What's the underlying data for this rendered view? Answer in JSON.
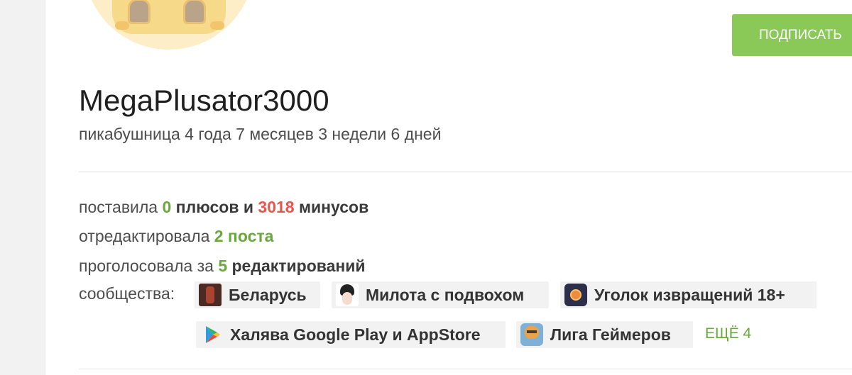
{
  "header": {
    "subscribe_label": "ПОДПИСАТЬ"
  },
  "profile": {
    "username": "MegaPlusator3000",
    "age_text": "пикабушница 4 года 7 месяцев 3 недели 6 дней"
  },
  "stats": {
    "votes": {
      "prefix": "поставила",
      "plus_count": "0",
      "plus_word": "плюсов и",
      "minus_count": "3018",
      "minus_word": "минусов"
    },
    "edits": {
      "prefix": "отредактировала",
      "value": "2 поста"
    },
    "voted_edits": {
      "prefix": "проголосовала за",
      "count": "5",
      "word": "редактирований"
    }
  },
  "communities": {
    "label": "сообщества:",
    "items": [
      {
        "label": "Беларусь",
        "icon": "belarus-community-icon"
      },
      {
        "label": "Милота с подвохом",
        "icon": "milota-community-icon"
      },
      {
        "label": "Уголок извращений 18+",
        "icon": "ugolok-community-icon"
      },
      {
        "label": "Халява Google Play и AppStore",
        "icon": "google-play-icon"
      },
      {
        "label": "Лига Геймеров",
        "icon": "gamers-league-icon"
      }
    ],
    "more_label": "ЕЩЁ 4"
  },
  "colors": {
    "accent_green": "#8ac858",
    "positive": "#6aa83c",
    "negative": "#e5564f"
  }
}
